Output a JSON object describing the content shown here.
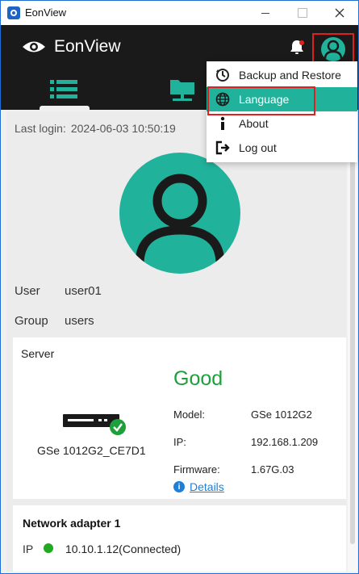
{
  "window": {
    "title": "EonView"
  },
  "header": {
    "brand": "EonView"
  },
  "last_login": {
    "label": "Last login:",
    "value": "2024-06-03 10:50:19"
  },
  "user": {
    "user_label": "User",
    "user_value": "user01",
    "group_label": "Group",
    "group_value": "users"
  },
  "server": {
    "section_title": "Server",
    "status": "Good",
    "device_name": "GSe 1012G2_CE7D1",
    "model_label": "Model:",
    "model_value": "GSe 1012G2",
    "ip_label": "IP:",
    "ip_value": "192.168.1.209",
    "firmware_label": "Firmware:",
    "firmware_value": "1.67G.03",
    "details_link": "Details"
  },
  "network": {
    "title": "Network adapter 1",
    "ip_label": "IP",
    "ip_value": "10.10.1.12(Connected)"
  },
  "menu": {
    "items": [
      {
        "label": "Backup and Restore",
        "icon": "backup-icon"
      },
      {
        "label": "Language",
        "icon": "globe-icon"
      },
      {
        "label": "About",
        "icon": "info-icon"
      },
      {
        "label": "Log out",
        "icon": "logout-icon"
      }
    ]
  },
  "colors": {
    "accent": "#20b29b",
    "header_bg": "#1a1a1a",
    "good": "#1e9f3c",
    "link": "#1e7fd6",
    "highlight_border": "#e02020"
  }
}
